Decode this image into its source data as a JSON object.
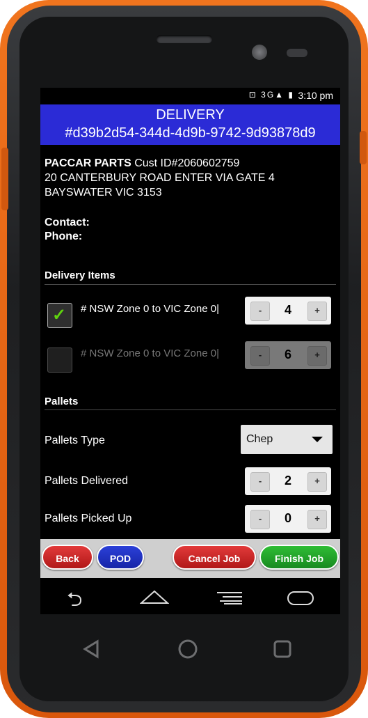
{
  "status": {
    "icons": "⊡ 3G▲ ▮",
    "time": "3:10 pm"
  },
  "header": {
    "title": "DELIVERY",
    "job_id": "#d39b2d54-344d-4d9b-9742-9d93878d9"
  },
  "customer": {
    "name": "PACCAR PARTS",
    "cust_id": "Cust ID#2060602759",
    "address_line1": "20 CANTERBURY ROAD ENTER VIA GATE 4",
    "address_line2": "BAYSWATER VIC 3153",
    "contact_label": "Contact:",
    "phone_label": "Phone:"
  },
  "delivery_items": {
    "heading": "Delivery Items",
    "items": [
      {
        "label": "# NSW Zone 0 to VIC Zone 0|",
        "checked": true,
        "quantity": "4",
        "minus": "-",
        "plus": "+"
      },
      {
        "label": "# NSW Zone 0 to VIC Zone 0|",
        "checked": false,
        "quantity": "6",
        "minus": "-",
        "plus": "+"
      }
    ]
  },
  "pallets": {
    "heading": "Pallets",
    "type_label": "Pallets Type",
    "type_value": "Chep",
    "delivered_label": "Pallets Delivered",
    "delivered_value": "2",
    "picked_label": "Pallets Picked Up",
    "picked_value": "0",
    "minus": "-",
    "plus": "+"
  },
  "actions": {
    "back": "Back",
    "pod": "POD",
    "cancel": "Cancel Job",
    "finish": "Finish Job"
  },
  "colors": {
    "title_bar": "#2b2bd6",
    "checkmark": "#5fd40e",
    "phone_orange": "#e8650f"
  },
  "icons": {
    "nav": [
      "back-arrow-icon",
      "home-icon",
      "menu-icon",
      "recent-apps-icon"
    ],
    "hardware": [
      "back-triangle-icon",
      "home-circle-icon",
      "recent-square-icon"
    ]
  }
}
